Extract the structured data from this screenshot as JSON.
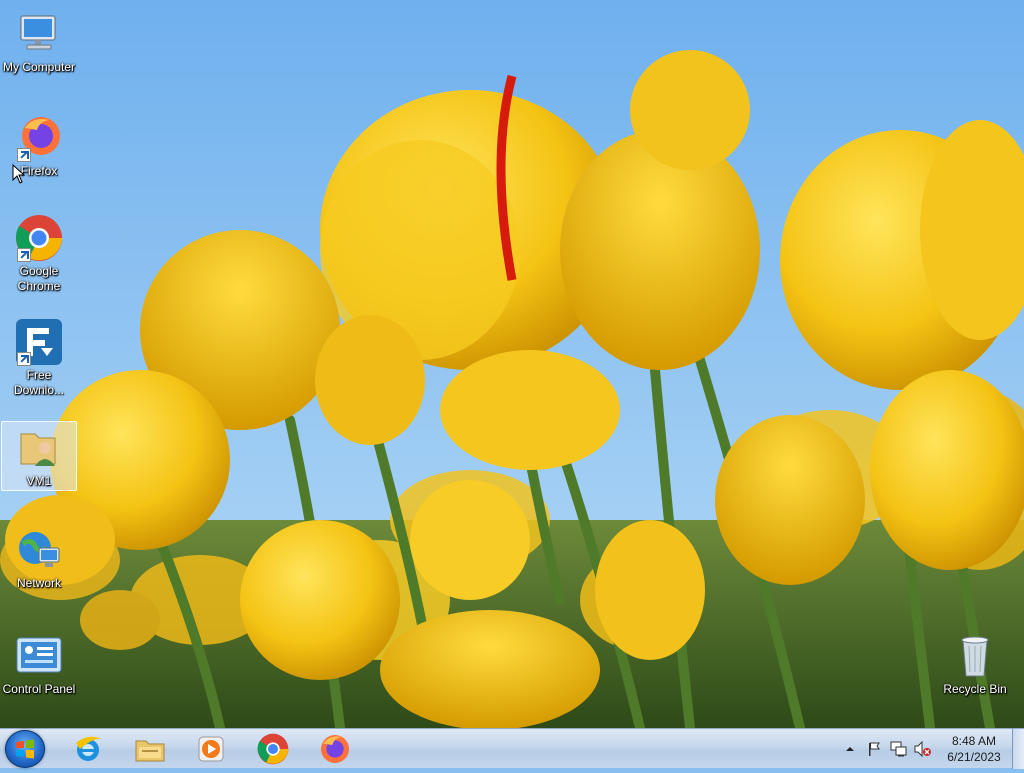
{
  "desktop": {
    "icons": [
      {
        "label": "My Computer",
        "icon": "computer-icon"
      },
      {
        "label": "Firefox",
        "icon": "firefox-icon"
      },
      {
        "label": "Google Chrome",
        "icon": "chrome-icon"
      },
      {
        "label": "Free Downlo...",
        "icon": "free-download-manager-icon"
      },
      {
        "label": "VM1",
        "icon": "user-folder-icon"
      },
      {
        "label": "Network",
        "icon": "network-icon"
      },
      {
        "label": "Control Panel",
        "icon": "control-panel-icon"
      },
      {
        "label": "Recycle Bin",
        "icon": "recycle-bin-icon"
      }
    ],
    "selected_icon": "VM1",
    "wallpaper": "yellow-tulips"
  },
  "taskbar": {
    "start": {
      "icon": "windows-start-icon"
    },
    "pinned": [
      {
        "name": "Internet Explorer",
        "icon": "internet-explorer-icon"
      },
      {
        "name": "Windows Explorer",
        "icon": "file-explorer-icon"
      },
      {
        "name": "Windows Media Player",
        "icon": "media-player-icon"
      },
      {
        "name": "Google Chrome",
        "icon": "chrome-icon"
      },
      {
        "name": "Firefox",
        "icon": "firefox-icon"
      }
    ],
    "tray": {
      "icons": [
        "show-hidden-icons-arrow",
        "action-center-flag-icon",
        "network-icon",
        "volume-muted-icon"
      ],
      "time": "8:48 AM",
      "date": "6/21/2023"
    }
  },
  "colors": {
    "sky": "#87bff0",
    "tulip": "#f5c518",
    "taskbar": "#c6d7ec"
  }
}
